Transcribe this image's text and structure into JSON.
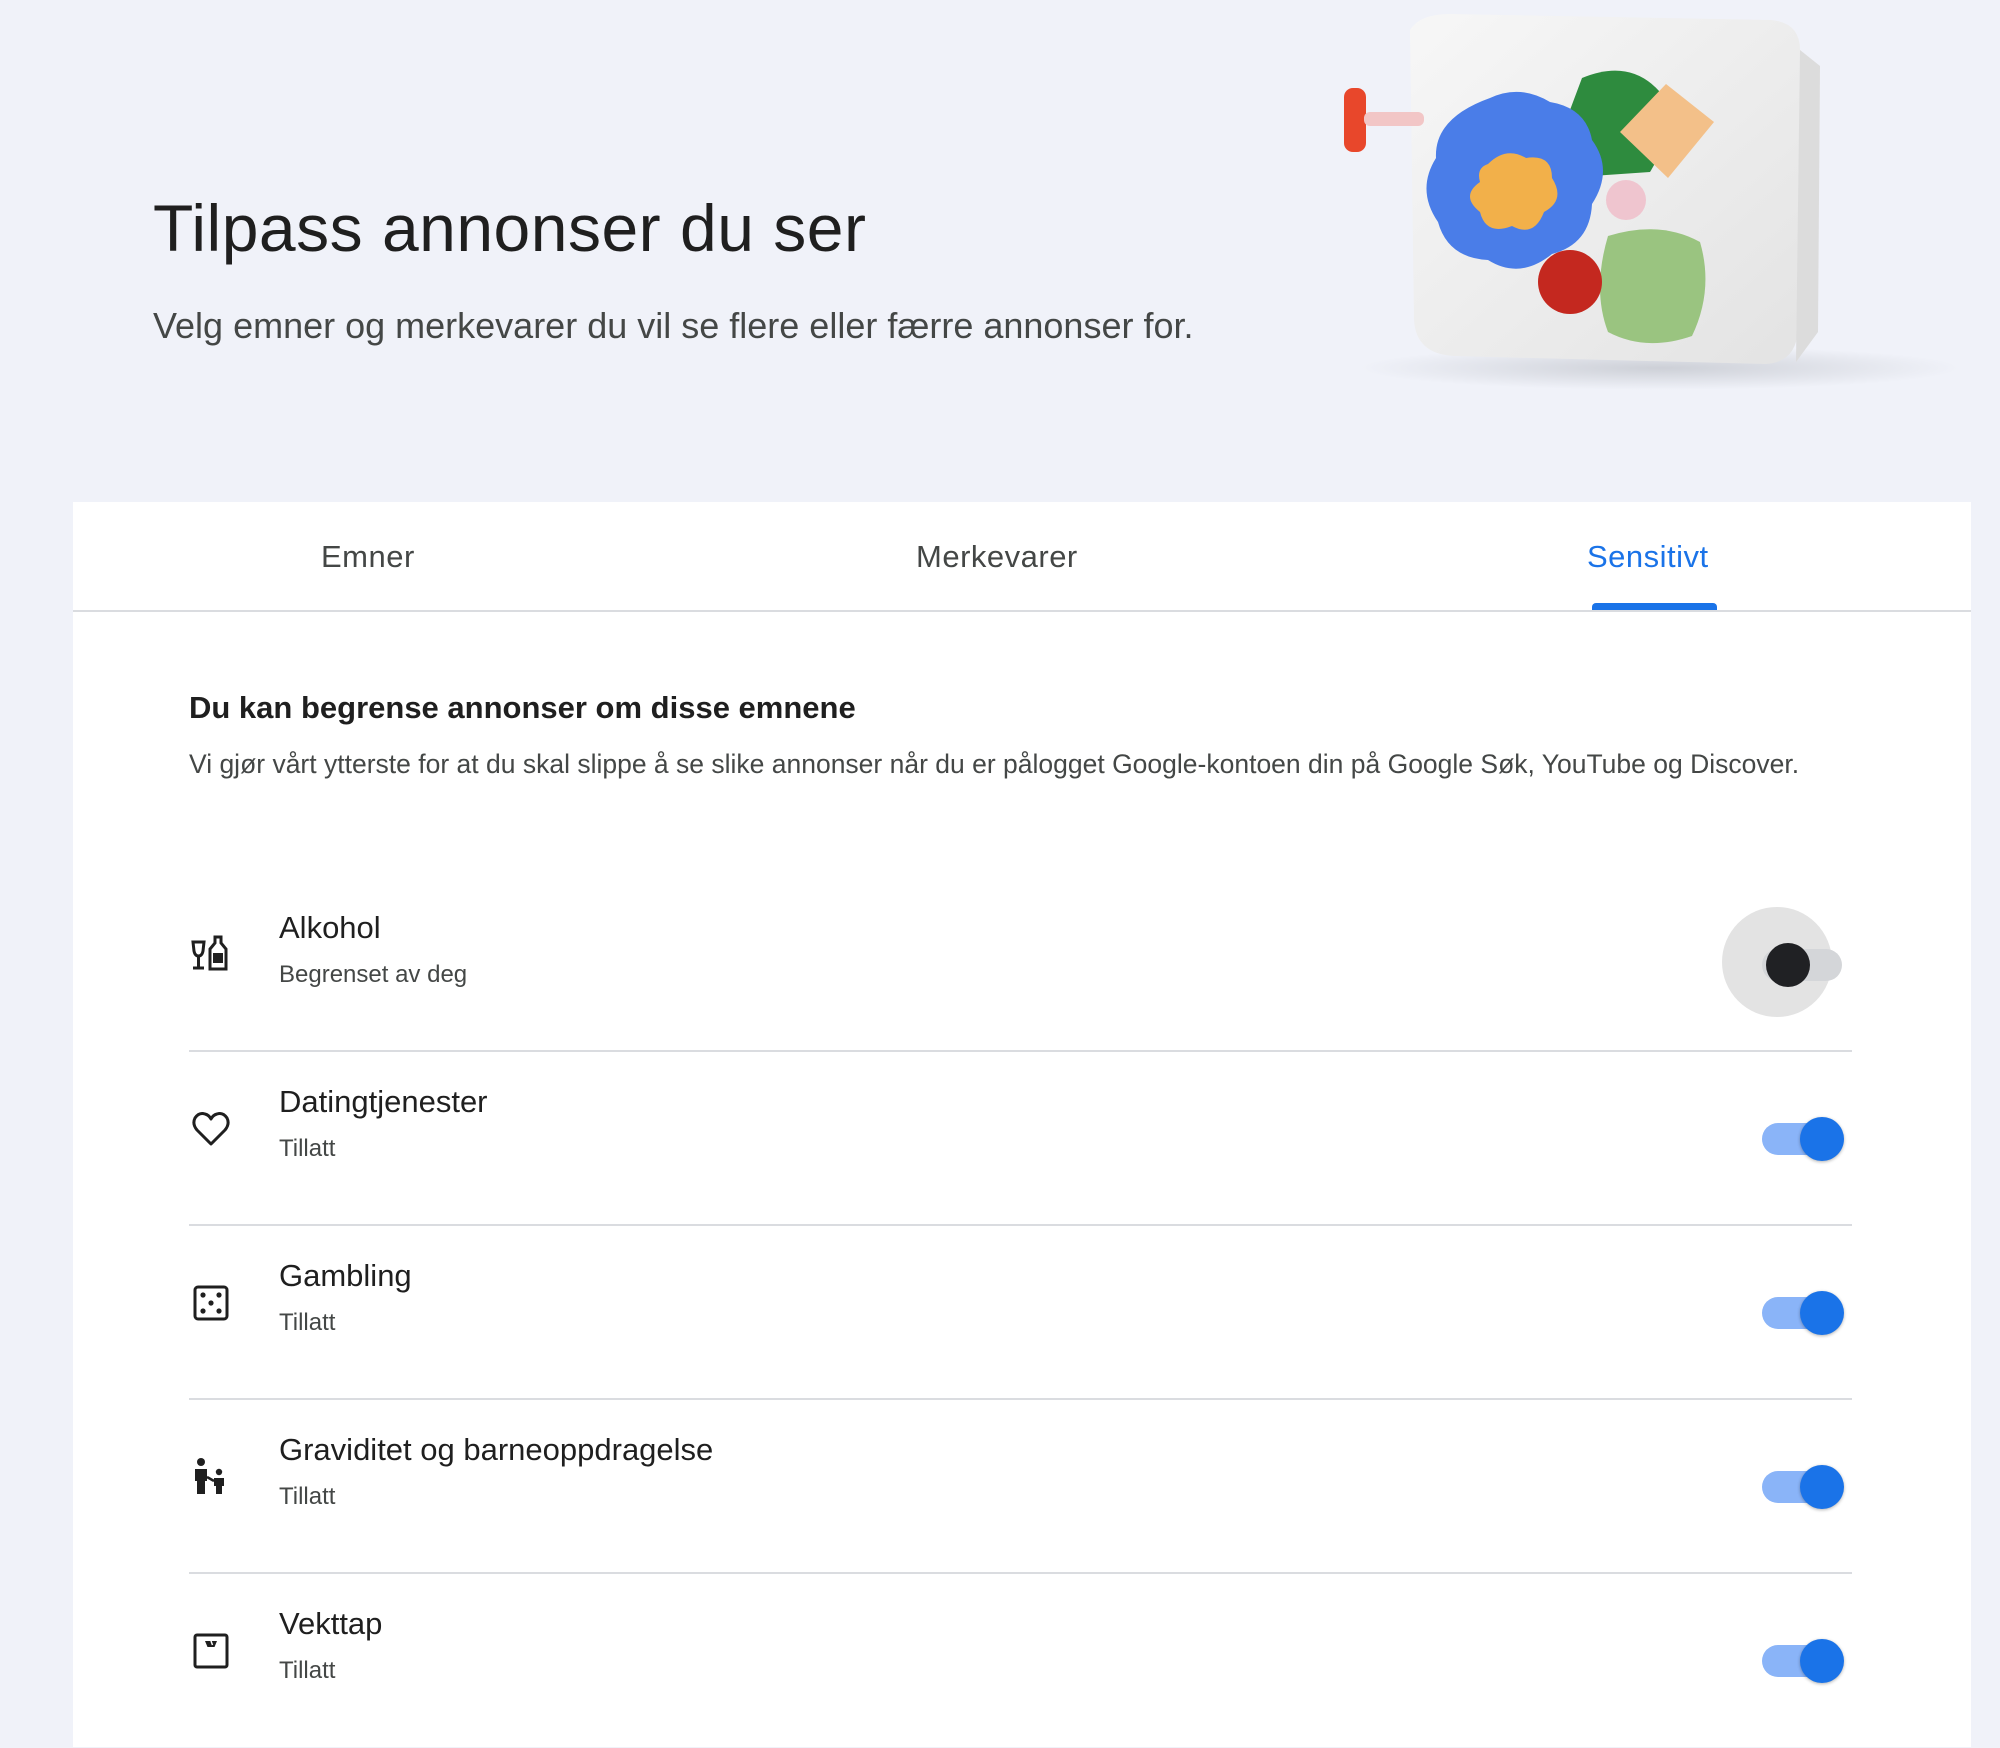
{
  "hero": {
    "title": "Tilpass annonser du ser",
    "subtitle": "Velg emner og merkevarer du vil se flere eller færre annonser for."
  },
  "tabs": [
    {
      "label": "Emner",
      "active": false
    },
    {
      "label": "Merkevarer",
      "active": false
    },
    {
      "label": "Sensitivt",
      "active": true
    }
  ],
  "section": {
    "heading": "Du kan begrense annonser om disse emnene",
    "description": "Vi gjør vårt ytterste for at du skal slippe å se slike annonser når du er pålogget Google-kontoen din på Google Søk, YouTube og Discover."
  },
  "items": [
    {
      "title": "Alkohol",
      "status": "Begrenset av deg",
      "icon": "wine-bottle-icon",
      "enabled": false
    },
    {
      "title": "Datingtjenester",
      "status": "Tillatt",
      "icon": "heart-icon",
      "enabled": true
    },
    {
      "title": "Gambling",
      "status": "Tillatt",
      "icon": "dice-icon",
      "enabled": true
    },
    {
      "title": "Graviditet og barneoppdragelse",
      "status": "Tillatt",
      "icon": "parent-child-icon",
      "enabled": true
    },
    {
      "title": "Vekttap",
      "status": "Tillatt",
      "icon": "scale-icon",
      "enabled": true
    }
  ],
  "colors": {
    "accent": "#1a73e8",
    "background": "#f0f2f9",
    "toggle_track_on": "#8ab4f8"
  }
}
